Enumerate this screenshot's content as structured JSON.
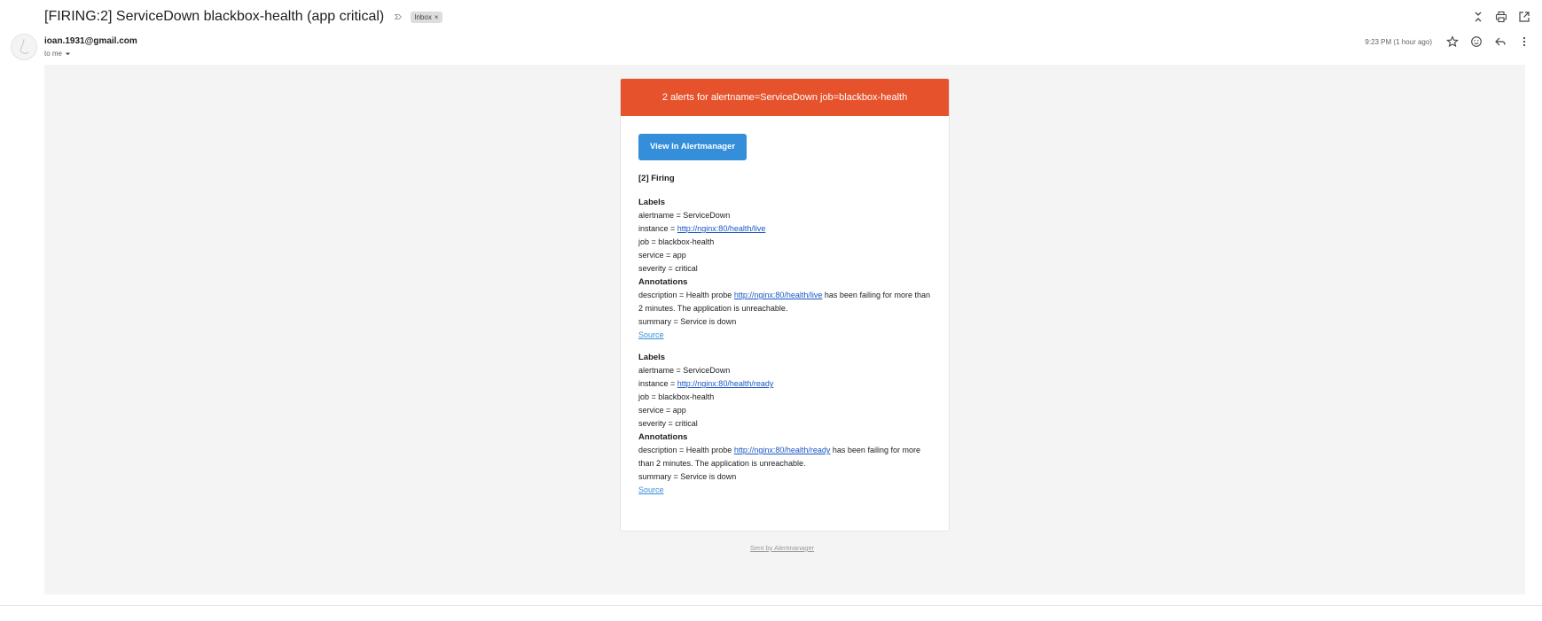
{
  "header": {
    "subject": "[FIRING:2] ServiceDown blackbox-health (app critical)",
    "label": "Inbox",
    "label_remove": "×",
    "icons": [
      "expand-collapse-icon",
      "print-icon",
      "open-new-window-icon"
    ]
  },
  "message": {
    "sender": "ioan.1931@gmail.com",
    "recipient": "to me",
    "timestamp": "9:23 PM (1 hour ago)",
    "icons": [
      "star-icon",
      "emoji-icon",
      "reply-icon",
      "more-vert-icon"
    ]
  },
  "email": {
    "banner": "2 alerts for alertname=ServiceDown job=blackbox-health",
    "button_label": "View In Alertmanager",
    "firing": "[2] Firing",
    "labels_title": "Labels",
    "annotations_title": "Annotations",
    "alerts": [
      {
        "alertname": "alertname = ServiceDown",
        "instance_prefix": "instance = ",
        "instance_url": "http://nginx:80/health/live",
        "job": "job = blackbox-health",
        "service": "service = app",
        "severity": "severity = critical",
        "desc_prefix": "description = Health probe ",
        "desc_url": "http://nginx:80/health/live",
        "desc_suffix": " has been failing for more than 2 minutes. The application is unreachable.",
        "summary": "summary = Service is down",
        "source": "Source"
      },
      {
        "alertname": "alertname = ServiceDown",
        "instance_prefix": "instance = ",
        "instance_url": "http://nginx:80/health/ready",
        "job": "job = blackbox-health",
        "service": "service = app",
        "severity": "severity = critical",
        "desc_prefix": "description = Health probe ",
        "desc_url": "http://nginx:80/health/ready",
        "desc_suffix": " has been failing for more than 2 minutes. The application is unreachable.",
        "summary": "summary = Service is down",
        "source": "Source"
      }
    ],
    "footer": "Sent by Alertmanager"
  },
  "colors": {
    "banner": "#e6522c",
    "button": "#348eda",
    "body_bg": "#f4f4f4",
    "link": "#1a56c4"
  }
}
